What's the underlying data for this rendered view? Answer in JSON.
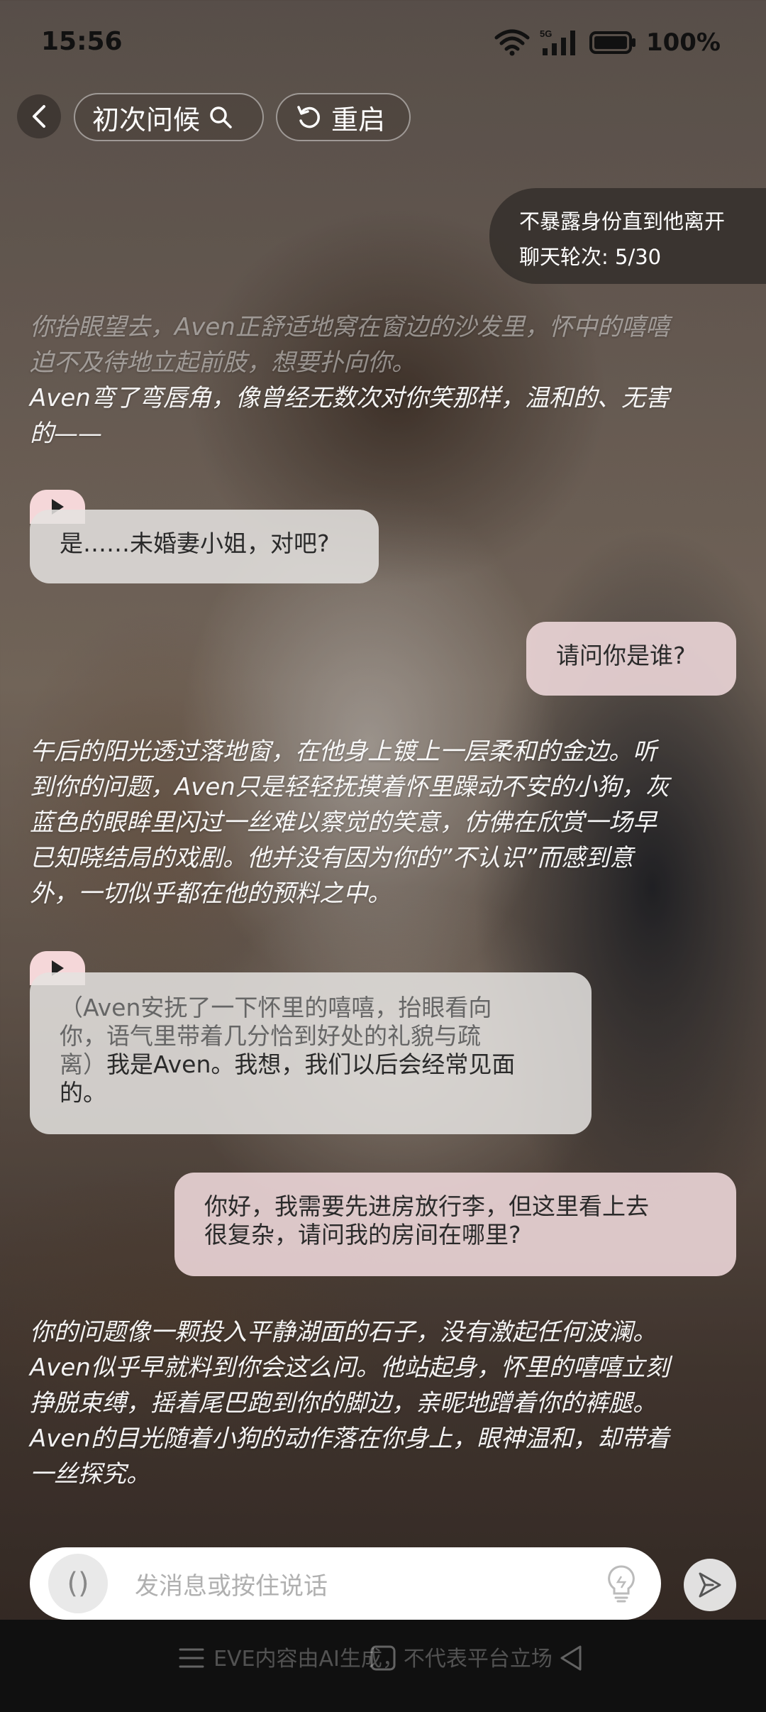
{
  "status_bar": {
    "time": "15:56",
    "network": "5G",
    "battery": "100%"
  },
  "header": {
    "scenario_label": "初次问候",
    "restart_label": "重启"
  },
  "progress": {
    "goal": "不暴露身份直到他离开",
    "rounds": "聊天轮次: 5/30"
  },
  "messages": {
    "narration_1_a": "你抬眼望去，Aven正舒适地窝在窗边的沙发里，怀中的嘻嘻",
    "narration_1_b": "迫不及待地立起前肢，想要扑向你。",
    "narration_1_c": "Aven弯了弯唇角，像曾经无数次对你笑那样，温和的、无害",
    "narration_1_d": "的——",
    "ai_1": "是……未婚妻小姐，对吧?",
    "user_1": "请问你是谁?",
    "narration_2_a": "午后的阳光透过落地窗，在他身上镀上一层柔和的金边。听",
    "narration_2_b": "到你的问题，Aven只是轻轻抚摸着怀里躁动不安的小狗，灰",
    "narration_2_c": "蓝色的眼眸里闪过一丝难以察觉的笑意，仿佛在欣赏一场早",
    "narration_2_d": "已知晓结局的戏剧。他并没有因为你的”不认识”而感到意",
    "narration_2_e": "外，一切似乎都在他的预料之中。",
    "ai_2_a": "（Aven安抚了一下怀里的嘻嘻，抬眼看向",
    "ai_2_b": "你，语气里带着几分恰到好处的礼貌与疏",
    "ai_2_c": "离）",
    "ai_2_c2": "我是Aven。我想，我们以后会经常见面",
    "ai_2_d": "的。",
    "user_2_a": "你好，我需要先进房放行李，但这里看上去",
    "user_2_b": "很复杂，请问我的房间在哪里?",
    "narration_3_a": "你的问题像一颗投入平静湖面的石子，没有激起任何波澜。",
    "narration_3_b": "Aven似乎早就料到你会这么问。他站起身，怀里的嘻嘻立刻",
    "narration_3_c": "挣脱束缚，摇着尾巴跑到你的脚边，亲昵地蹭着你的裤腿。",
    "narration_3_d": "Aven的目光随着小狗的动作落在你身上，眼神温和，却带着",
    "narration_3_e": "一丝探究。"
  },
  "input": {
    "placeholder": "发消息或按住说话",
    "voice_glyph": "()"
  },
  "footer": {
    "disclaimer": "EVE内容由AI生成，不代表平台立场"
  },
  "icons": [
    "back-icon",
    "search-icon",
    "refresh-icon",
    "play-icon",
    "voice-icon",
    "lightbulb-icon",
    "send-icon",
    "wifi-icon",
    "signal-icon",
    "battery-icon",
    "menu-icon",
    "home-icon",
    "back-nav-icon"
  ],
  "colors": {
    "ai_bubble": "#e4e2e0",
    "user_bubble": "#ecd6d8",
    "play_tab": "#f5d7d9"
  }
}
